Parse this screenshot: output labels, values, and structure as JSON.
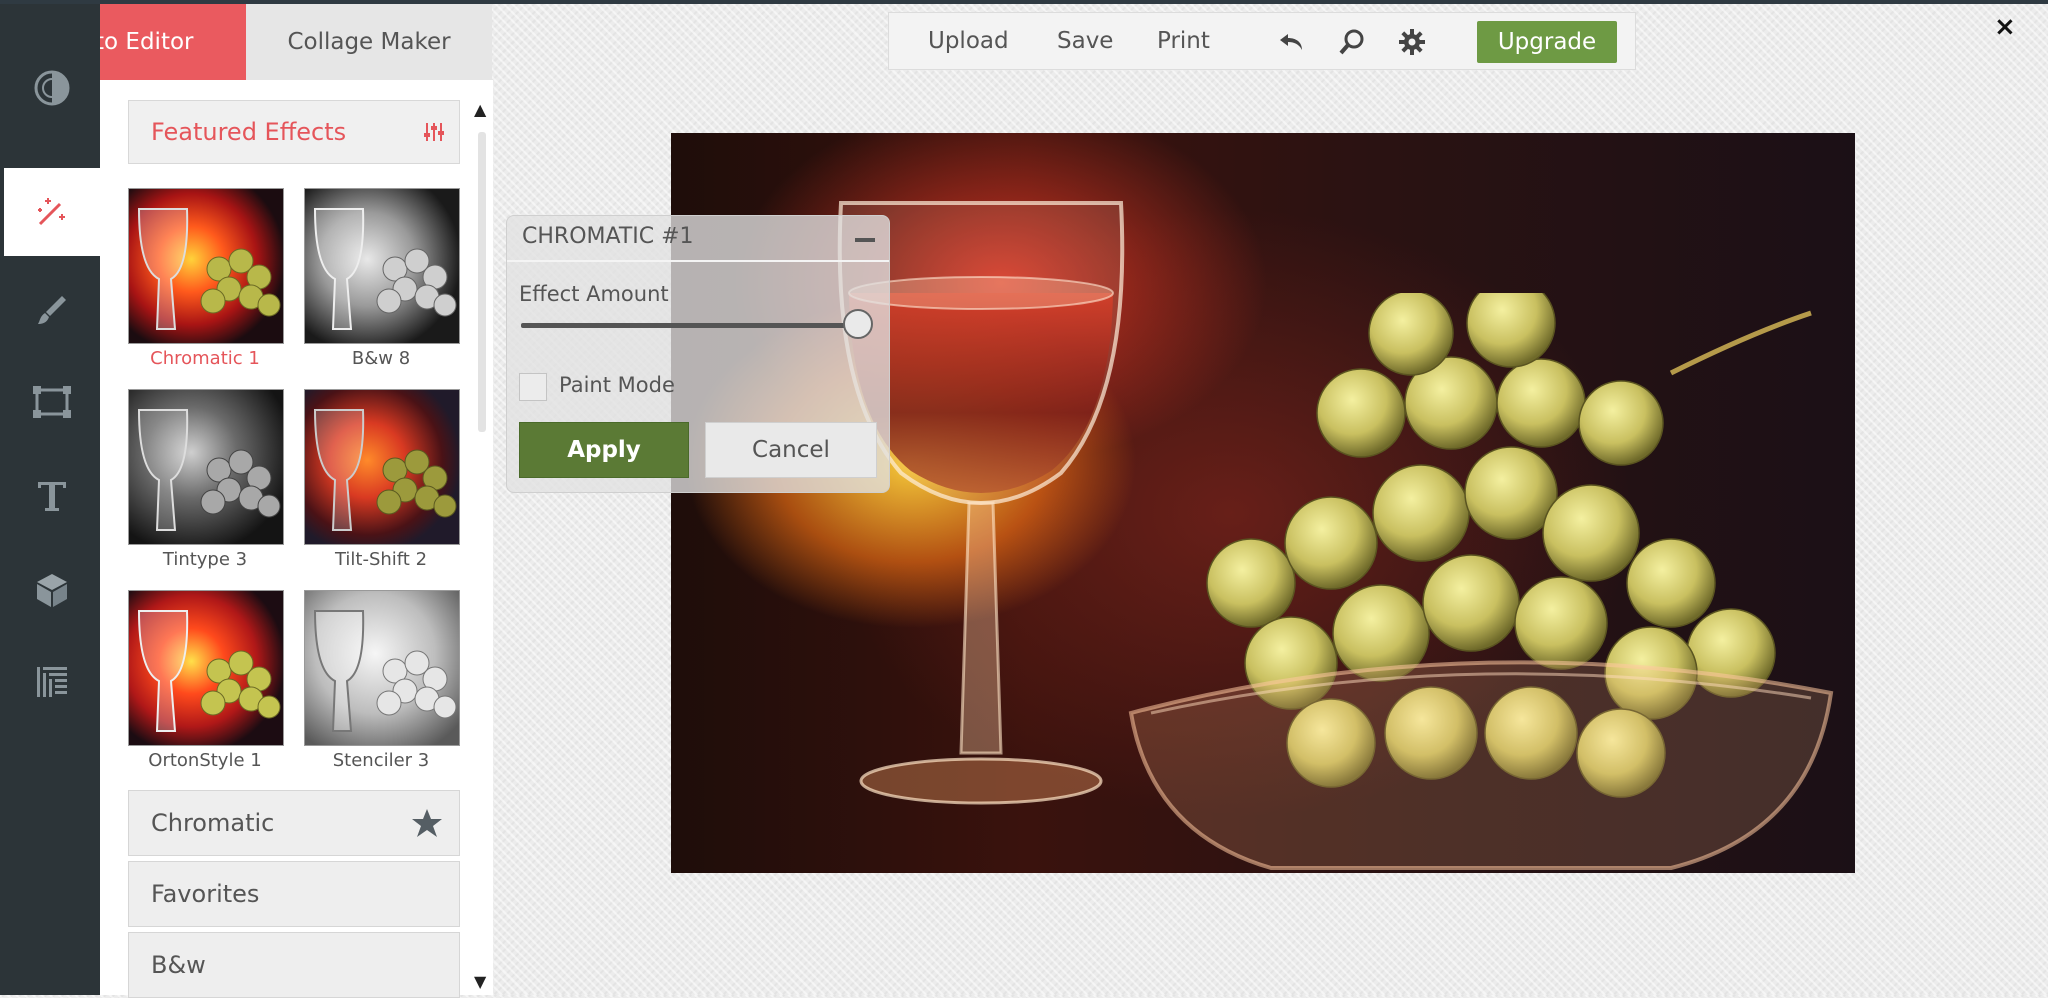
{
  "modes": {
    "photo_editor": "Photo Editor",
    "collage_maker": "Collage Maker"
  },
  "rail": {
    "items": [
      {
        "icon": "contrast-icon",
        "active": false
      },
      {
        "icon": "magic-wand-icon",
        "active": true
      },
      {
        "icon": "brush-icon",
        "active": false
      },
      {
        "icon": "frame-icon",
        "active": false
      },
      {
        "icon": "text-icon",
        "active": false
      },
      {
        "icon": "cube-icon",
        "active": false
      },
      {
        "icon": "texture-icon",
        "active": false
      }
    ]
  },
  "panel": {
    "featured_title": "Featured Effects",
    "thumbnails": [
      {
        "label": "Chromatic 1",
        "selected": true,
        "style": "color"
      },
      {
        "label": "B&w 8",
        "selected": false,
        "style": "bw"
      },
      {
        "label": "Tintype 3",
        "selected": false,
        "style": "bw-dark"
      },
      {
        "label": "Tilt-Shift 2",
        "selected": false,
        "style": "color-dark"
      },
      {
        "label": "OrtonStyle 1",
        "selected": false,
        "style": "color"
      },
      {
        "label": "Stenciler 3",
        "selected": false,
        "style": "bw-light"
      }
    ],
    "categories": [
      {
        "label": "Chromatic",
        "starred": true
      },
      {
        "label": "Favorites",
        "starred": false
      },
      {
        "label": "B&w",
        "starred": false
      }
    ],
    "scroll_up": "▲",
    "scroll_down": "▼"
  },
  "toolbar": {
    "upload": "Upload",
    "save": "Save",
    "print": "Print",
    "icons": [
      "undo-icon",
      "search-icon",
      "gear-icon"
    ],
    "upgrade": "Upgrade"
  },
  "close": "×",
  "dialog": {
    "title": "CHROMATIC #1",
    "effect_amount_label": "Effect Amount",
    "effect_amount_value": 1.0,
    "paint_mode_label": "Paint Mode",
    "paint_mode_checked": false,
    "apply": "Apply",
    "cancel": "Cancel"
  },
  "colors": {
    "accent_red": "#ea5a5f",
    "upgrade_green": "#6e9a44",
    "apply_green": "#5b7a35",
    "rail_dark": "#2c3438"
  }
}
